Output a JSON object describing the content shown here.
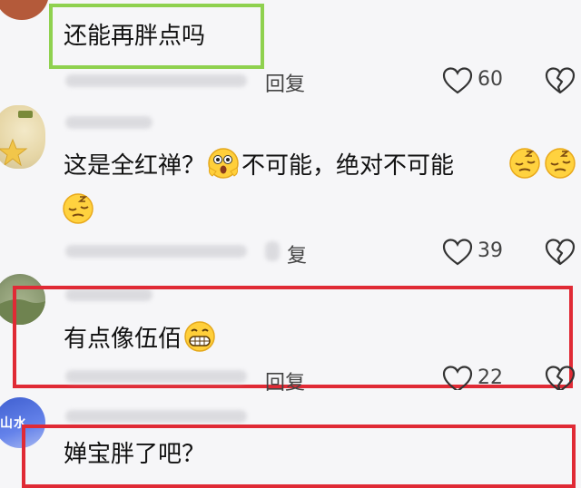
{
  "comments": [
    {
      "text": "还能再胖点吗",
      "reply_label": "回复",
      "like_count": "60"
    },
    {
      "text_part1": "这是全红禅？",
      "text_part2": "不可能，绝对不可能",
      "reply_label": "复",
      "like_count": "39"
    },
    {
      "text": "有点像伍佰",
      "reply_label": "回复",
      "like_count": "22"
    },
    {
      "text": "婵宝胖了吧？"
    }
  ],
  "avatar_badge_text": "山水",
  "icons": [
    "heart-icon",
    "broken-heart-icon",
    "shocked-emoji",
    "sleepy-emoji",
    "grin-emoji"
  ],
  "colors": {
    "green_highlight": "#8fd14f",
    "red_highlight": "#e02a35",
    "background": "#f6f6f8"
  }
}
